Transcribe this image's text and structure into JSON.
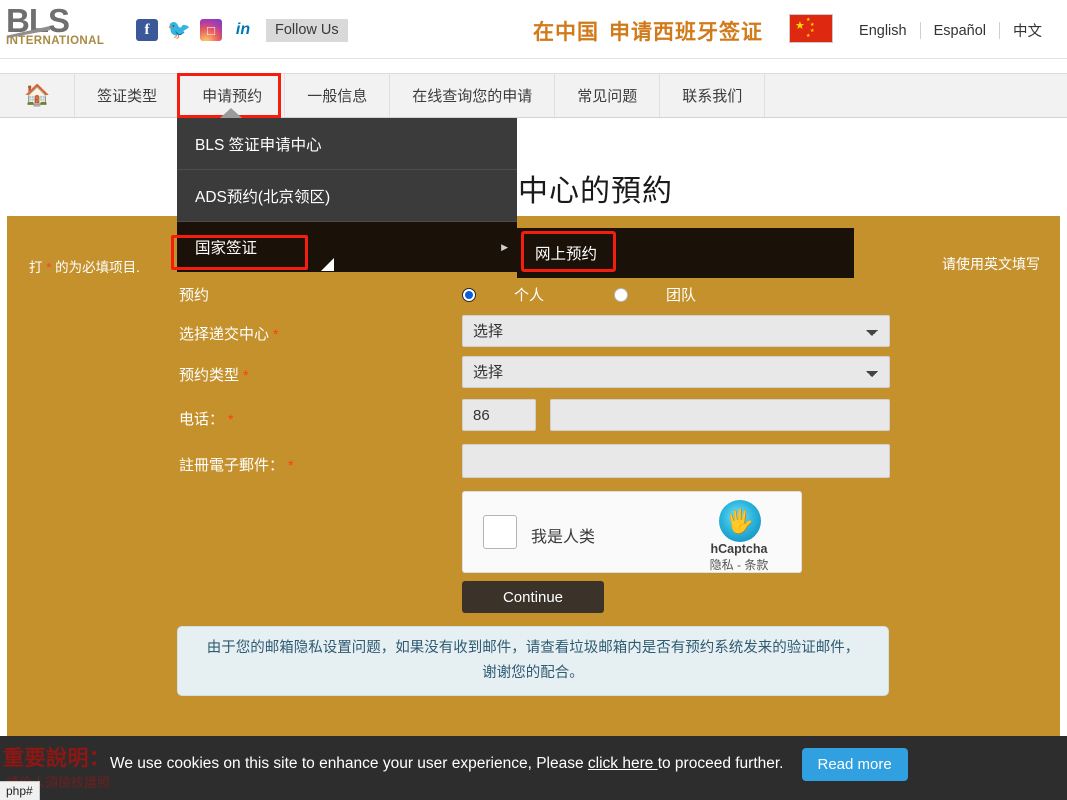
{
  "header": {
    "logo_main": "BLS",
    "logo_sub": "INTERNATIONAL",
    "follow_label": "Follow Us",
    "social": [
      {
        "name": "facebook-icon",
        "glyph": "f"
      },
      {
        "name": "twitter-icon",
        "glyph": "🐦"
      },
      {
        "name": "instagram-icon",
        "glyph": "▣"
      },
      {
        "name": "linkedin-icon",
        "glyph": "in"
      }
    ],
    "cn_title_1": "在中国",
    "cn_title_2": "申请西班牙签证",
    "flag_name": "china-flag",
    "languages": [
      "English",
      "Español",
      "中文"
    ]
  },
  "nav": {
    "home_icon": "home-icon",
    "items": [
      "签证类型",
      "申请预约",
      "一般信息",
      "在线查询您的申请",
      "常见问题",
      "联系我们"
    ],
    "active_index": 1,
    "highlight_color": "#f51d0e"
  },
  "dropdown": {
    "items": [
      "BLS 签证申请中心",
      "ADS预约(北京领区)",
      "国家签证"
    ],
    "highlighted_item": "国家签证",
    "submenu_items": [
      "网上预约"
    ],
    "arrow_glyph": "▶"
  },
  "page": {
    "title": "簽證申請中心的預約"
  },
  "form": {
    "required_note_prefix": "打",
    "required_note_star": "*",
    "required_note_suffix": "的为必填项目.",
    "english_note": "请使用英文填写",
    "appointment_label": "预约",
    "radio_individual": "个人",
    "radio_group": "团队",
    "radio_selected": "个人",
    "center_label": "选择递交中心",
    "center_value": "选择",
    "center_options": [
      "选择"
    ],
    "type_label": "预约类型",
    "type_value": "选择",
    "type_options": [
      "选择"
    ],
    "phone_label": "电话：",
    "phone_code": "86",
    "phone_value": "",
    "email_label": "註冊電子郵件：",
    "email_value": "",
    "continue_label": "Continue",
    "info_text": "由于您的邮箱隐私设置问题，如果没有收到邮件，请查看垃圾邮箱内是否有预约系统发来的验证邮件，谢谢您的配合。"
  },
  "captcha": {
    "checkbox_label": "我是人类",
    "brand": "hCaptcha",
    "terms": "隐私 - 条款",
    "logo_icon": "hand-icon"
  },
  "footer": {
    "important_note": "重要說明：",
    "important_body": "請价人須檢核護照的所有詳情 (姓名、護照號碼、出生日期、護照簽發日期、護照有效期) 確認預約前。一旦保存了詳細資訊，您可能必須取消預約，如果詳細資訊不正確。",
    "cookie_text_before": "We use cookies on this site to enhance your user experience, Please ",
    "cookie_link": "click here ",
    "cookie_text_after": "to proceed further.",
    "read_more_label": "Read more",
    "status_url": "php#"
  }
}
